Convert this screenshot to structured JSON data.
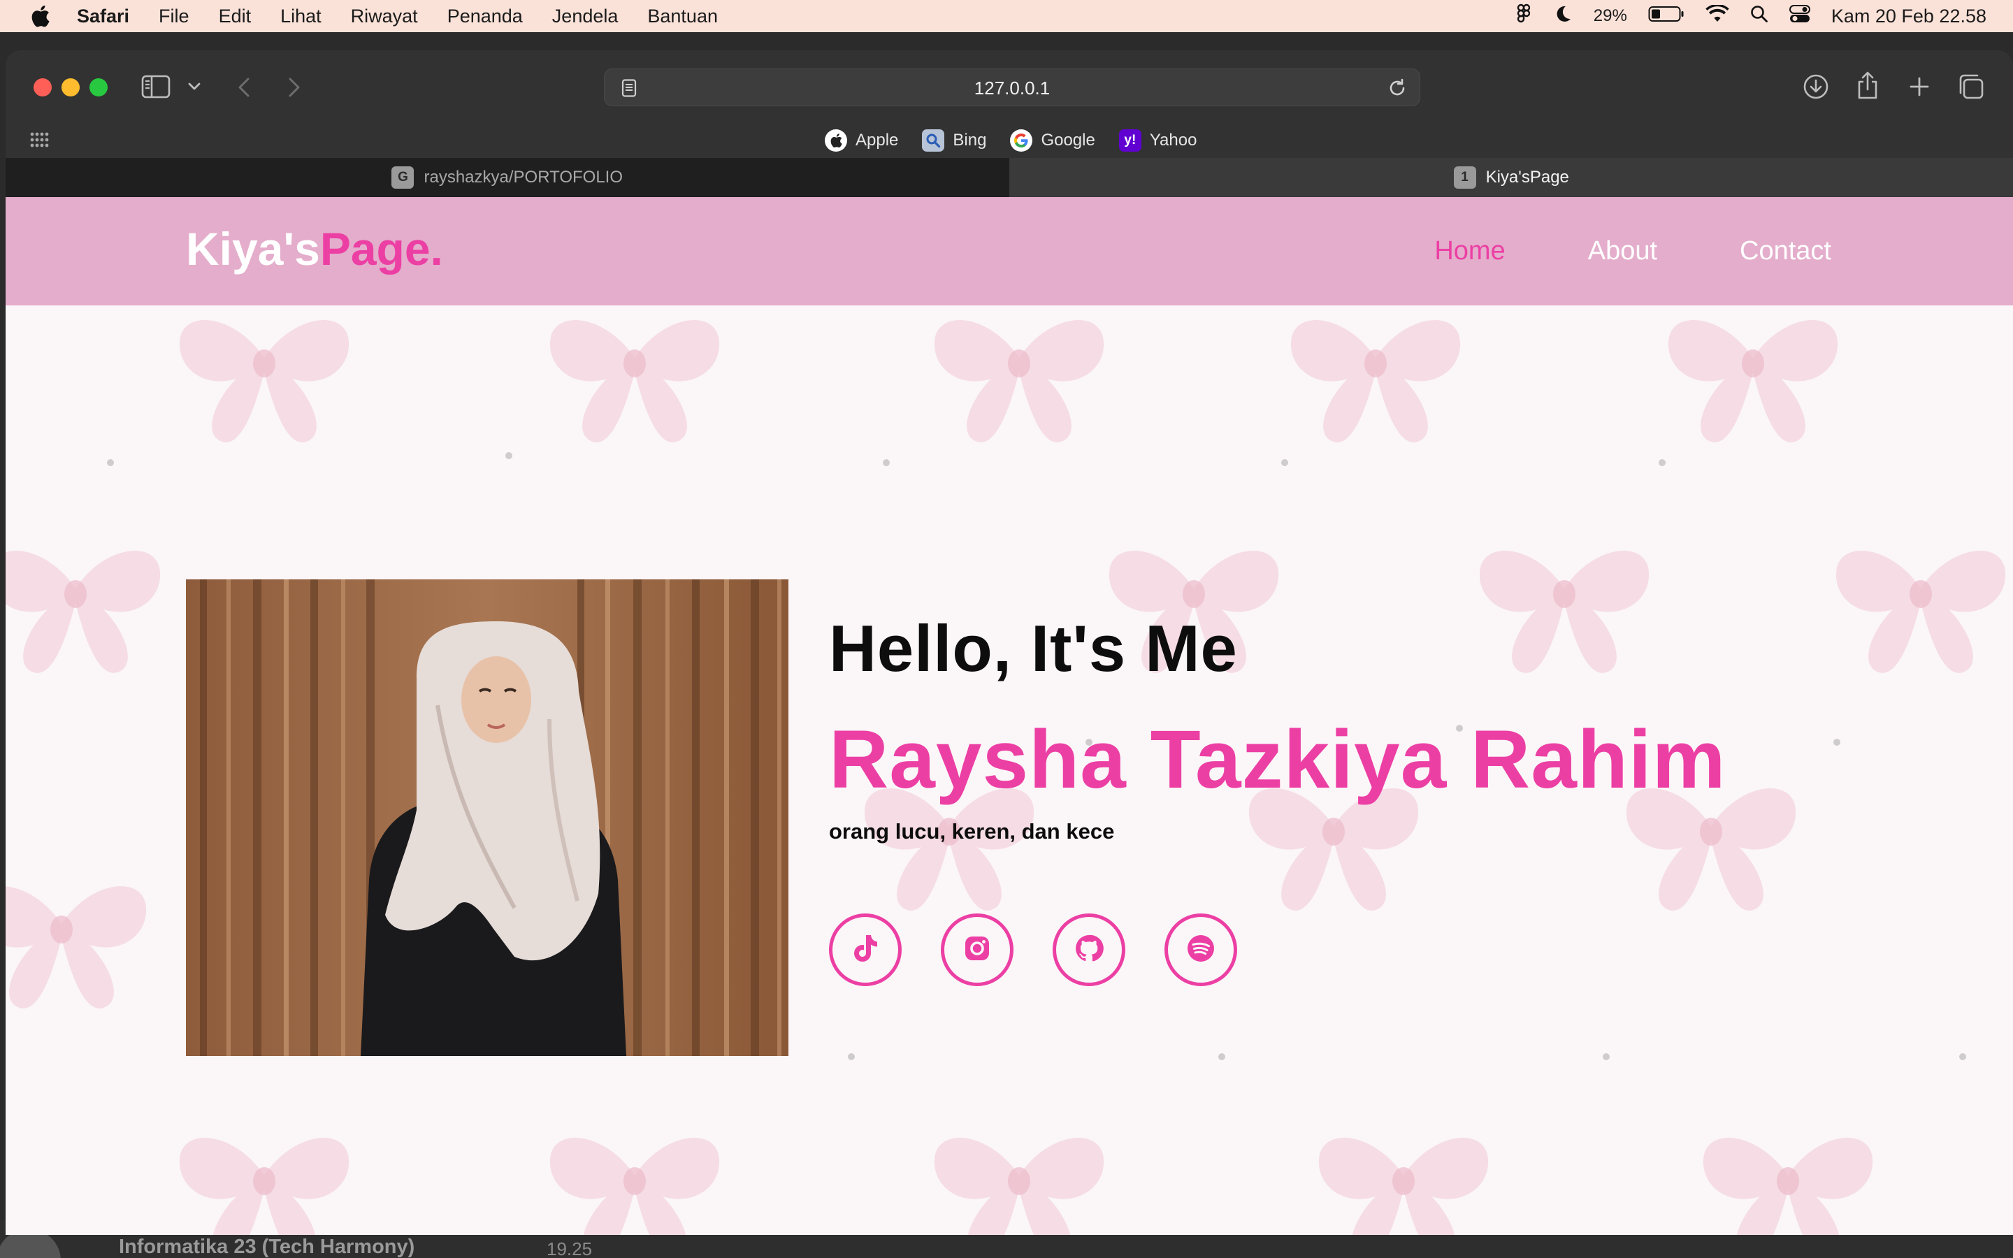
{
  "menubar": {
    "app_name": "Safari",
    "items": [
      "File",
      "Edit",
      "Lihat",
      "Riwayat",
      "Penanda",
      "Jendela",
      "Bantuan"
    ],
    "battery": "29%",
    "clock": "Kam 20 Feb  22.58"
  },
  "browser": {
    "url": "127.0.0.1",
    "favorites": [
      {
        "label": "Apple",
        "icon": "apple-icon"
      },
      {
        "label": "Bing",
        "icon": "bing-icon"
      },
      {
        "label": "Google",
        "icon": "google-icon"
      },
      {
        "label": "Yahoo",
        "icon": "yahoo-icon"
      }
    ],
    "tabs": [
      {
        "label": "rayshazkya/PORTOFOLIO",
        "badge": "G",
        "active": false
      },
      {
        "label": "Kiya'sPage",
        "badge": "1",
        "active": true
      }
    ]
  },
  "site": {
    "logo_part1": "Kiya's",
    "logo_part2": "Page.",
    "nav": [
      "Home",
      "About",
      "Contact"
    ],
    "nav_active": "Home",
    "greeting": "Hello, It's Me",
    "name": "Raysha Tazkiya Rahim",
    "tagline": "orang lucu, keren, dan kece",
    "socials": [
      "tiktok-icon",
      "instagram-icon",
      "github-icon",
      "spotify-icon"
    ],
    "colors": {
      "accent": "#ec3fa4",
      "header_bg": "#e4adcb",
      "page_bg": "#fbf6f8",
      "text": "#0d0d0d"
    }
  },
  "background_window": {
    "item_label": "Informatika 23 (Tech Harmony)",
    "item_time": "19.25"
  }
}
